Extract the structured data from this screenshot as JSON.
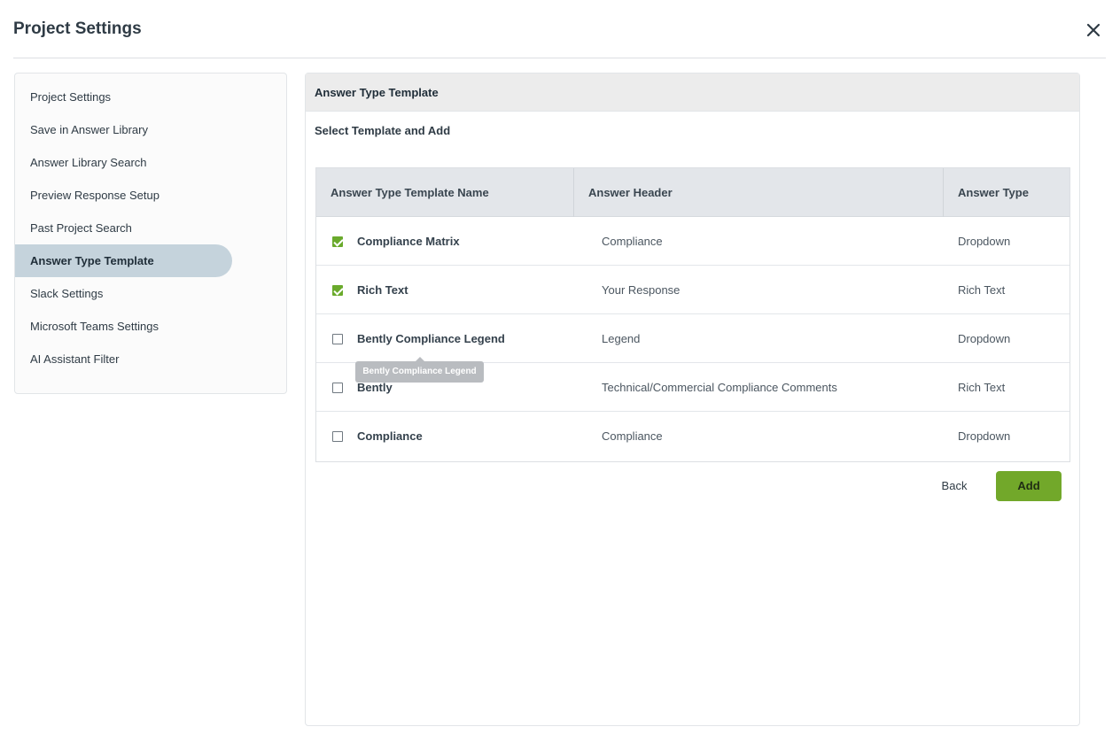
{
  "header": {
    "title": "Project Settings",
    "close_icon": "close-icon"
  },
  "sidebar": {
    "items": [
      {
        "label": "Project Settings",
        "active": false
      },
      {
        "label": "Save in Answer Library",
        "active": false
      },
      {
        "label": "Answer Library Search",
        "active": false
      },
      {
        "label": "Preview Response Setup",
        "active": false
      },
      {
        "label": "Past Project Search",
        "active": false
      },
      {
        "label": "Answer Type Template",
        "active": true
      },
      {
        "label": "Slack Settings",
        "active": false
      },
      {
        "label": "Microsoft Teams Settings",
        "active": false
      },
      {
        "label": "AI Assistant Filter",
        "active": false
      }
    ]
  },
  "main": {
    "panel_title": "Answer Type Template",
    "subtitle": "Select Template and Add",
    "table": {
      "columns": [
        "Answer Type Template Name",
        "Answer Header",
        "Answer Type"
      ],
      "rows": [
        {
          "name": "Compliance Matrix",
          "header": "Compliance",
          "type": "Dropdown",
          "checked": true
        },
        {
          "name": "Rich Text",
          "header": "Your Response",
          "type": "Rich Text",
          "checked": true
        },
        {
          "name": "Bently Compliance Legend",
          "header": "Legend",
          "type": "Dropdown",
          "checked": false
        },
        {
          "name": "Bently",
          "header": "Technical/Commercial Compliance Comments",
          "type": "Rich Text",
          "checked": false
        },
        {
          "name": "Compliance",
          "header": "Compliance",
          "type": "Dropdown",
          "checked": false
        }
      ]
    },
    "tooltip": "Bently Compliance Legend",
    "back_label": "Back",
    "add_label": "Add"
  },
  "colors": {
    "accent": "#72a82a",
    "checkbox_checked": "#6aaa2c",
    "active_sidebar": "#c5d3dc"
  }
}
